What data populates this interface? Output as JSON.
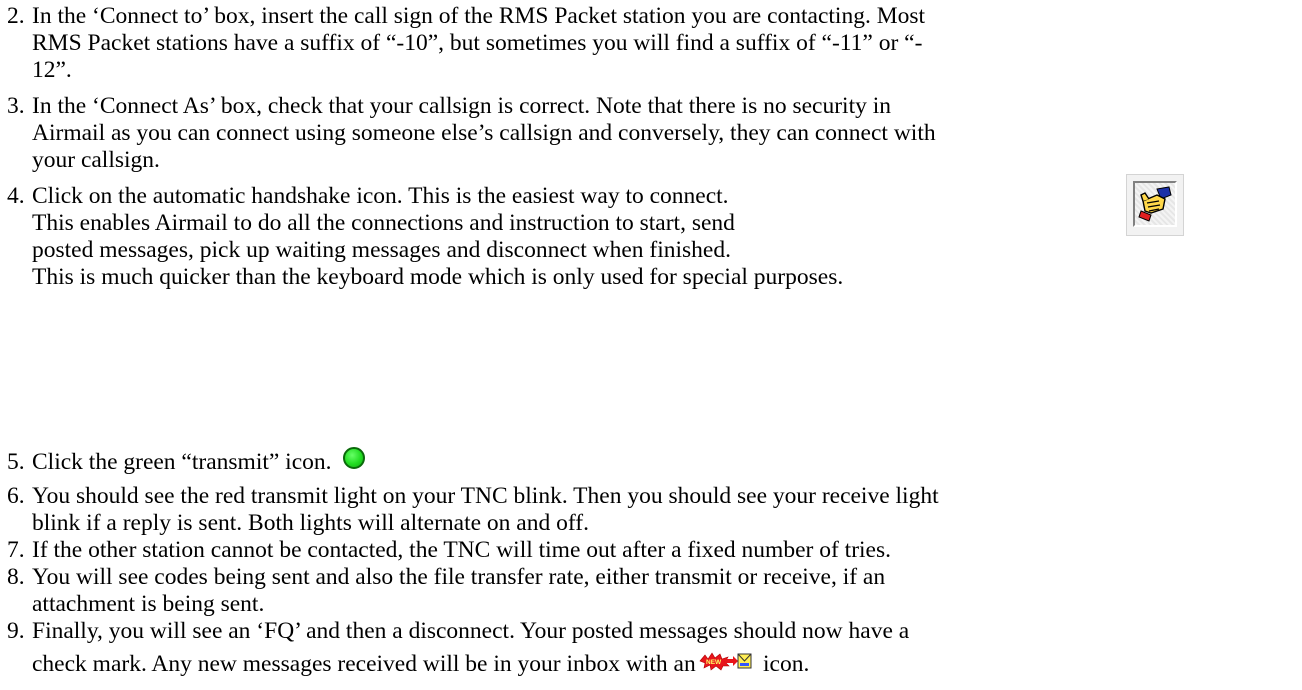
{
  "items": [
    {
      "number": "2.",
      "lines": [
        "In the ‘Connect to’ box, insert the call sign of the RMS Packet station you are contacting. Most",
        "RMS Packet stations have a suffix of “-10”, but sometimes you will find a suffix of “-11” or “-",
        "12”."
      ]
    },
    {
      "number": "3.",
      "lines": [
        "In the ‘Connect As’ box, check that your callsign is correct. Note that there is no security in",
        "Airmail as you can connect using someone else’s callsign and conversely, they can connect with",
        "your callsign."
      ]
    },
    {
      "number": "4.",
      "lines": [
        "Click on the automatic handshake icon. This is the easiest way to connect.",
        "This enables Airmail to do all the connections and instruction to start, send",
        "posted messages, pick up waiting messages and disconnect when finished.",
        "This is much quicker than the keyboard mode which is only used for special purposes."
      ]
    },
    {
      "number": "5.",
      "lines": [
        "Click the green “transmit” icon."
      ]
    },
    {
      "number": "6.",
      "lines": [
        "You should see the red transmit light on your TNC blink. Then you should see your receive light",
        "blink if a reply is sent. Both lights will alternate on and off."
      ]
    },
    {
      "number": "7.",
      "lines": [
        "If the other station cannot be contacted, the TNC will time out after a fixed number of tries."
      ]
    },
    {
      "number": "8.",
      "lines": [
        "You will see codes being sent and also the file transfer rate, either transmit or receive, if an",
        "attachment is being sent."
      ]
    },
    {
      "number": "9.",
      "lines": [
        "Finally, you will see an ‘FQ’ and then a disconnect. Your posted messages should now have a",
        "check mark. Any new messages received will be in your inbox with an",
        "icon."
      ]
    }
  ],
  "icons": {
    "handshake": "handshake-icon",
    "transmit": "green-transmit-icon",
    "transmit_color": "#22dd22",
    "new_message": "new-message-icon",
    "new_message_badge": "NEW"
  }
}
